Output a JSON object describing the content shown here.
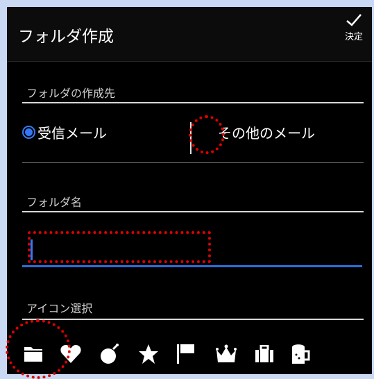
{
  "header": {
    "title": "フォルダ作成",
    "confirm_label": "決定"
  },
  "destination": {
    "label": "フォルダの作成先",
    "options": [
      {
        "label": "受信メール",
        "selected": true
      },
      {
        "label": "その他のメール",
        "selected": false
      }
    ]
  },
  "folder_name": {
    "label": "フォルダ名",
    "value": "",
    "placeholder": ""
  },
  "icon_select": {
    "label": "アイコン選択",
    "icons": [
      "folder-icon",
      "heart-icon",
      "bomb-icon",
      "star-icon",
      "flag-icon",
      "crown-icon",
      "briefcase-icon",
      "beer-mug-icon"
    ]
  },
  "colors": {
    "accent": "#3478f6",
    "annotation": "#e00000",
    "background": "#c9d9f3"
  }
}
